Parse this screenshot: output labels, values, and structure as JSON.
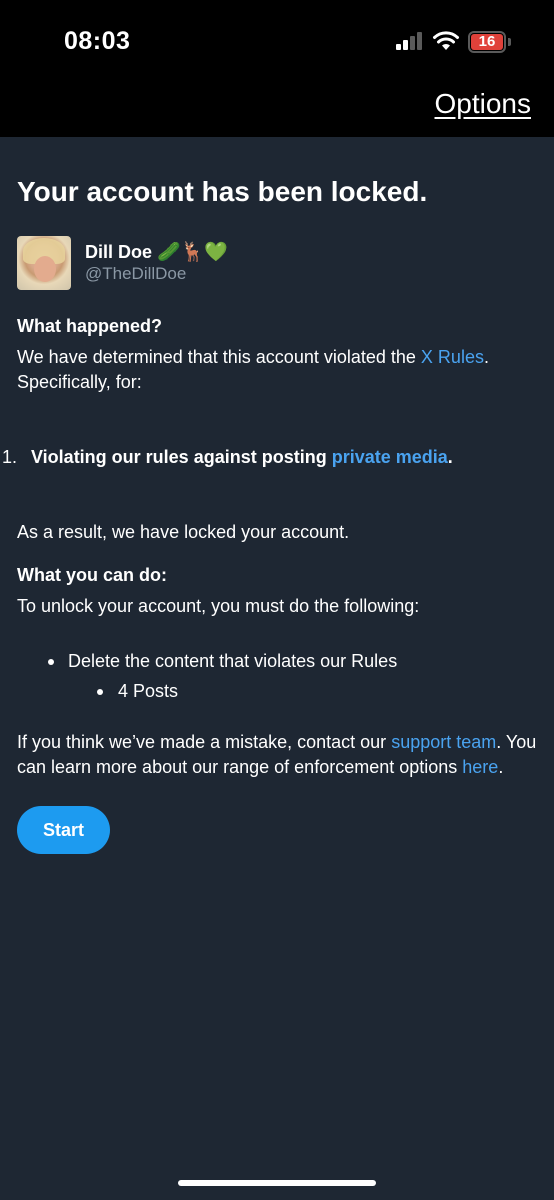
{
  "status_bar": {
    "time": "08:03",
    "battery_level": "16",
    "battery_color": "#e0413a"
  },
  "header": {
    "options_label": "Options"
  },
  "page": {
    "title": "Your account has been locked."
  },
  "user": {
    "display_name": "Dill Doe",
    "name_emojis": "🥒🦌💚",
    "handle": "@TheDillDoe"
  },
  "what_happened": {
    "heading": "What happened?",
    "text_before": "We have determined that this account violated the ",
    "rules_link": "X Rules",
    "text_after": ". Specifically, for:"
  },
  "violation": {
    "number": "1.",
    "text_before": "Violating our rules against posting ",
    "link": "private media",
    "text_after": "."
  },
  "result_text": "As a result, we have locked your account.",
  "what_you_can_do": {
    "heading": "What you can do:",
    "text": "To unlock your account, you must do the following:",
    "bullet": "Delete the content that violates our Rules",
    "sub_bullet": "4 Posts"
  },
  "mistake": {
    "text1": "If you think we’ve made a mistake, contact our ",
    "support_link": "support team",
    "text2": ". You can learn more about our range of enforcement options ",
    "here_link": "here",
    "text3": "."
  },
  "actions": {
    "start_label": "Start"
  },
  "colors": {
    "background": "#1e2733",
    "link": "#4aa3f0",
    "button": "#1d9bf0"
  }
}
